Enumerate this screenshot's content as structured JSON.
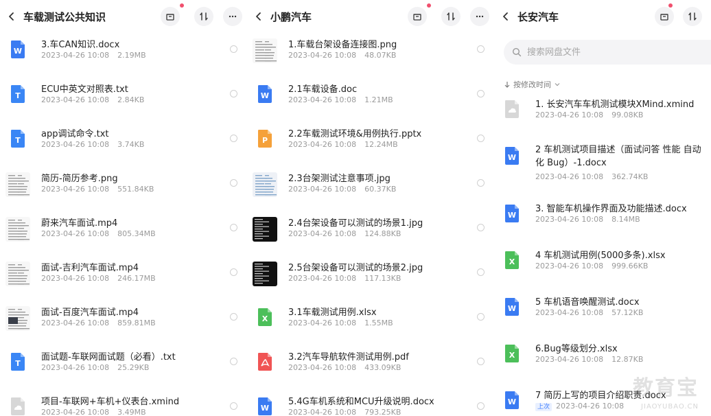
{
  "panels": [
    {
      "title": "车载测试公共知识",
      "files": [
        {
          "name": "3.车CAN知识.docx",
          "date": "2023-04-26  10:08",
          "size": "2.19MB",
          "icon": "word-icon"
        },
        {
          "name": "ECU中英文对照表.txt",
          "date": "2023-04-26  10:08",
          "size": "2.84KB",
          "icon": "txt-icon"
        },
        {
          "name": "app调试命令.txt",
          "date": "2023-04-26  10:08",
          "size": "3.74KB",
          "icon": "txt-icon"
        },
        {
          "name": "简历-简历参考.png",
          "date": "2023-04-26  10:08",
          "size": "551.84KB",
          "icon": "doc-thumb"
        },
        {
          "name": "蔚来汽车面试.mp4",
          "date": "2023-04-26  10:08",
          "size": "805.34MB",
          "icon": "doc-thumb"
        },
        {
          "name": "面试-吉利汽车面试.mp4",
          "date": "2023-04-26  10:08",
          "size": "246.17MB",
          "icon": "doc-thumb"
        },
        {
          "name": "面试-百度汽车面试.mp4",
          "date": "2023-04-26  10:08",
          "size": "859.81MB",
          "icon": "doc-thumb-dark"
        },
        {
          "name": "面试题-车联网面试题（必看）.txt",
          "date": "2023-04-26  10:08",
          "size": "25.29KB",
          "icon": "txt-icon"
        },
        {
          "name": "项目-车联网+车机+仪表台.xmind",
          "date": "2023-04-26  10:08",
          "size": "3.49MB",
          "icon": "xmind-icon"
        }
      ]
    },
    {
      "title": "小鹏汽车",
      "files": [
        {
          "name": "1.车载台架设备连接图.png",
          "date": "2023-04-26  10:08",
          "size": "48.07KB",
          "icon": "diagram-thumb"
        },
        {
          "name": "2.1车载设备.doc",
          "date": "2023-04-26  10:08",
          "size": "1.21MB",
          "icon": "word-icon"
        },
        {
          "name": "2.2车载测试环境&用例执行.pptx",
          "date": "2023-04-26  10:08",
          "size": "12.24MB",
          "icon": "ppt-icon"
        },
        {
          "name": "2.3台架测试注意事项.jpg",
          "date": "2023-04-26  10:08",
          "size": "60.37KB",
          "icon": "sheet-thumb"
        },
        {
          "name": "2.4台架设备可以测试的场景1.jpg",
          "date": "2023-04-26  10:08",
          "size": "124.88KB",
          "icon": "terminal-thumb"
        },
        {
          "name": "2.5台架设备可以测试的场景2.jpg",
          "date": "2023-04-26  10:08",
          "size": "117.13KB",
          "icon": "terminal-thumb"
        },
        {
          "name": "3.1车载测试用例.xlsx",
          "date": "2023-04-26  10:08",
          "size": "1.55MB",
          "icon": "excel-icon"
        },
        {
          "name": "3.2汽车导航软件测试用例.pdf",
          "date": "2023-04-26  10:08",
          "size": "433.09KB",
          "icon": "pdf-icon"
        },
        {
          "name": "5.4G车机系统和MCU升级说明.docx",
          "date": "2023-04-26  10:08",
          "size": "793.25KB",
          "icon": "word-icon"
        }
      ]
    },
    {
      "title": "长安汽车",
      "search_placeholder": "搜索网盘文件",
      "sort_label": "按修改时间",
      "files": [
        {
          "name": "1. 长安汽车车机测试模块XMind.xmind",
          "date": "2023-04-26  10:08",
          "size": "99.08KB",
          "icon": "xmind-icon"
        },
        {
          "name": "2 车机测试项目描述（面试问答 性能 自动化 Bug）-1.docx",
          "date": "2023-04-26  10:08",
          "size": "362.74KB",
          "icon": "word-icon"
        },
        {
          "name": "3. 智能车机操作界面及功能描述.docx",
          "date": "2023-04-26  10:08",
          "size": "8.14MB",
          "icon": "word-icon"
        },
        {
          "name": "4 车机测试用例(5000多条).xlsx",
          "date": "2023-04-26  10:08",
          "size": "999.66KB",
          "icon": "excel-icon"
        },
        {
          "name": "5 车机语音唤醒测试.docx",
          "date": "2023-04-26  10:08",
          "size": "57.12KB",
          "icon": "word-icon"
        },
        {
          "name": "6.Bug等级划分.xlsx",
          "date": "2023-04-26  10:08",
          "size": "12.87KB",
          "icon": "excel-icon"
        },
        {
          "name": "7 简历上写的项目介绍职责.docx",
          "date": "2023-04-26  10:08",
          "size": "",
          "icon": "word-icon",
          "badge": "上次"
        }
      ]
    }
  ],
  "watermark": "教育宝",
  "watermark_url": "JIAOYUBAO.CN",
  "colors": {
    "word": "#3a7bf2",
    "txt": "#3a86f5",
    "excel": "#4cbf5a",
    "ppt": "#f5a13a",
    "pdf": "#f05454",
    "xmind": "#d7d7d7",
    "accent_dot": "#f0506e"
  }
}
